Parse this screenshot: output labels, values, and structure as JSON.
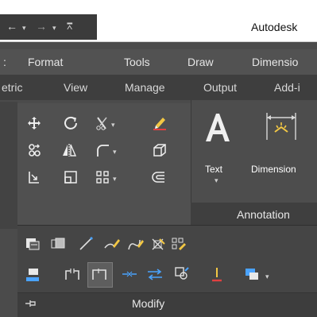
{
  "app": {
    "title": "Autodesk"
  },
  "quick_access": {
    "icons": [
      "back-arrow-icon",
      "forward-arrow-icon",
      "customize-dropdown-icon"
    ]
  },
  "menubar": {
    "items": [
      "Format",
      "Tools",
      "Draw",
      "Dimensio"
    ]
  },
  "tabs": {
    "items": [
      "etric",
      "View",
      "Manage",
      "Output",
      "Add-i"
    ]
  },
  "modify_panel": {
    "title": "Modify",
    "tools": [
      {
        "name": "move-icon"
      },
      {
        "name": "rotate-icon"
      },
      {
        "name": "trim-icon"
      },
      {
        "name": "erase-icon"
      },
      {
        "name": "copy-icon"
      },
      {
        "name": "mirror-icon"
      },
      {
        "name": "fillet-icon"
      },
      {
        "name": "3d-box-icon"
      },
      {
        "name": "stretch-icon"
      },
      {
        "name": "scale-icon"
      },
      {
        "name": "array-icon"
      },
      {
        "name": "offset-icon"
      }
    ],
    "expanded_tools_row1": [
      "draw-order-icon",
      "bring-to-front-icon",
      "lengthen-icon",
      "pencil-edit-icon",
      "edit-polyline-icon",
      "explode-icon",
      "array-edit-icon"
    ],
    "expanded_tools_row2": [
      "align-icon",
      "break-icon",
      "join-icon",
      "break-at-point-icon",
      "reverse-icon",
      "copy-properties-icon",
      "blend-icon",
      "overkill-icon"
    ]
  },
  "annotation_panel": {
    "title": "Annotation",
    "text_label": "Text",
    "dimension_label": "Dimension"
  }
}
